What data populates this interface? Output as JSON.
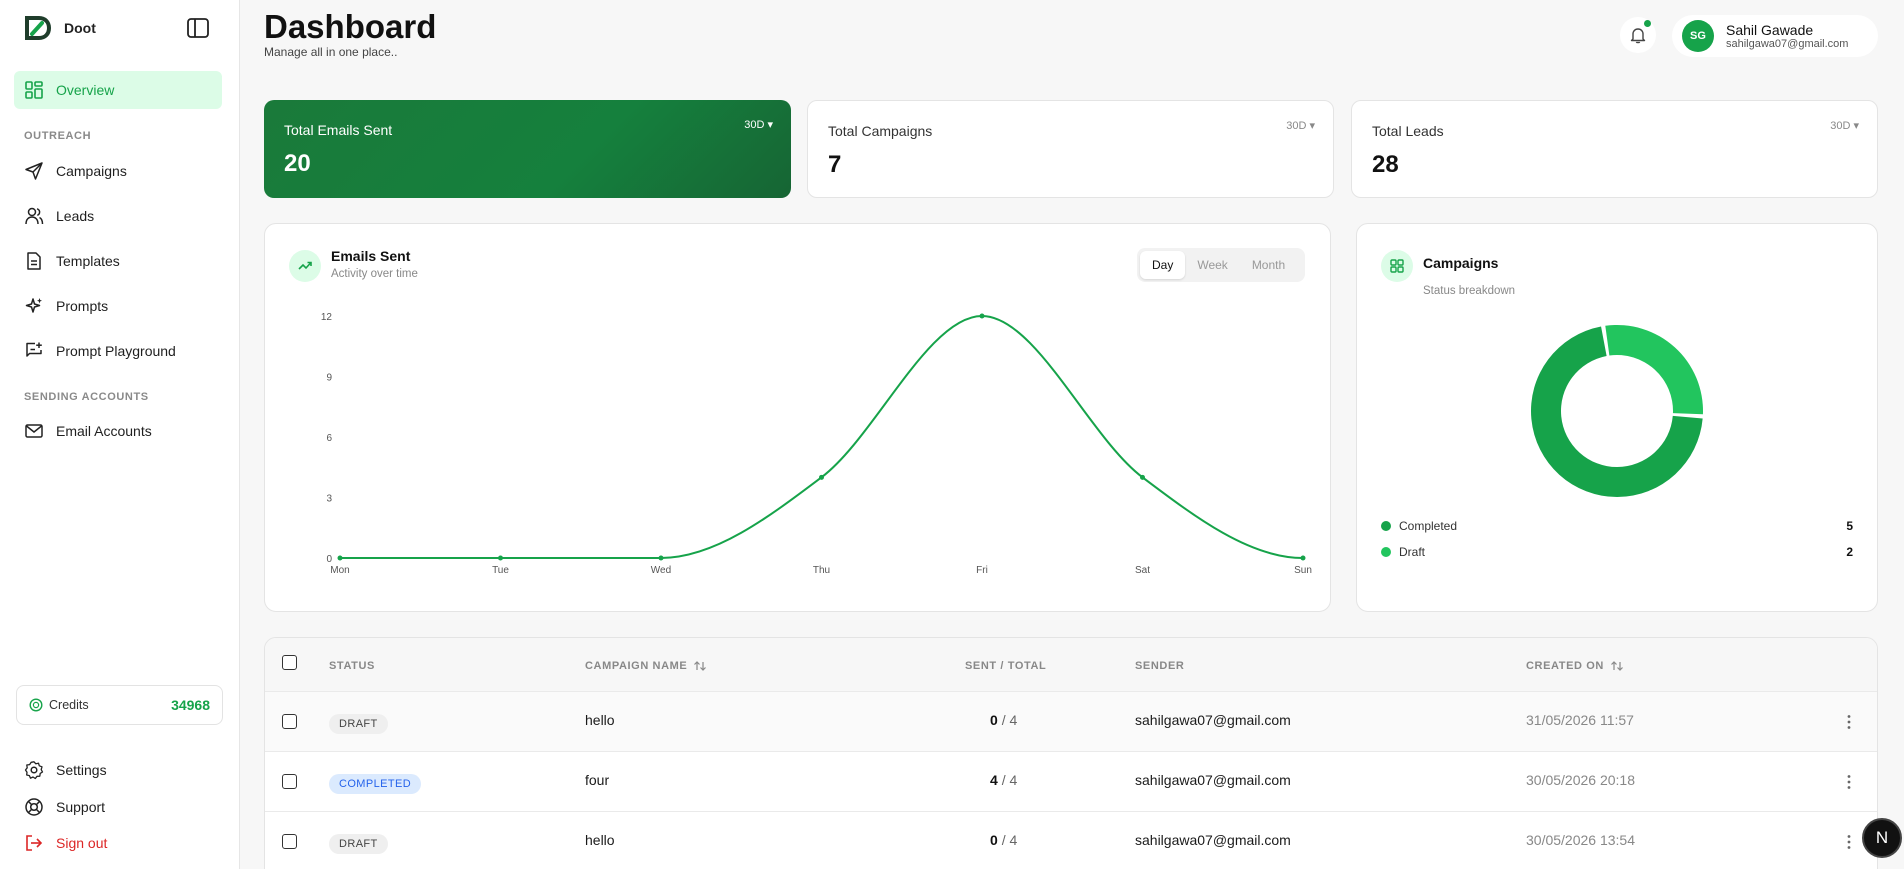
{
  "app": {
    "name": "Doot"
  },
  "sidebar": {
    "overview_label": "Overview",
    "outreach_heading": "OUTREACH",
    "outreach_items": [
      {
        "label": "Campaigns",
        "icon": "send-icon"
      },
      {
        "label": "Leads",
        "icon": "users-icon"
      },
      {
        "label": "Templates",
        "icon": "file-text-icon"
      },
      {
        "label": "Prompts",
        "icon": "sparkles-icon"
      },
      {
        "label": "Prompt Playground",
        "icon": "message-plus-icon"
      }
    ],
    "sending_heading": "SENDING ACCOUNTS",
    "email_accounts_label": "Email Accounts",
    "credits_label": "Credits",
    "credits_value": "34968",
    "settings_label": "Settings",
    "support_label": "Support",
    "signout_label": "Sign out"
  },
  "header": {
    "title": "Dashboard",
    "subtitle": "Manage all in one place..",
    "user_initials": "SG",
    "user_name": "Sahil Gawade",
    "user_email": "sahilgawa07@gmail.com"
  },
  "stats": [
    {
      "label": "Total Emails Sent",
      "value": "20",
      "range": "30D"
    },
    {
      "label": "Total Campaigns",
      "value": "7",
      "range": "30D"
    },
    {
      "label": "Total Leads",
      "value": "28",
      "range": "30D"
    }
  ],
  "emails_panel": {
    "title": "Emails Sent",
    "subtitle": "Activity over time",
    "tabs": [
      "Day",
      "Week",
      "Month"
    ],
    "active_tab": "Day"
  },
  "campaigns_panel": {
    "title": "Campaigns",
    "subtitle": "Status breakdown",
    "legend": [
      {
        "label": "Completed",
        "count": "5",
        "color": "#16a34a"
      },
      {
        "label": "Draft",
        "count": "2",
        "color": "#22c55e"
      }
    ]
  },
  "chart_data": [
    {
      "type": "line",
      "title": "Emails Sent",
      "categories": [
        "Mon",
        "Tue",
        "Wed",
        "Thu",
        "Fri",
        "Sat",
        "Sun"
      ],
      "values": [
        0,
        0,
        0,
        4,
        12,
        4,
        0
      ],
      "y_ticks": [
        0,
        3,
        6,
        9,
        12
      ],
      "ylim": [
        0,
        12
      ],
      "color": "#16a34a"
    },
    {
      "type": "pie",
      "title": "Campaigns",
      "labels": [
        "Completed",
        "Draft"
      ],
      "values": [
        5,
        2
      ],
      "colors": [
        "#16a34a",
        "#22c55e"
      ]
    }
  ],
  "table": {
    "columns": {
      "status": "STATUS",
      "name": "CAMPAIGN NAME",
      "sent": "SENT / TOTAL",
      "sender": "SENDER",
      "created": "CREATED ON"
    },
    "rows": [
      {
        "status": "DRAFT",
        "name": "hello",
        "sent": "0",
        "total": "/ 4",
        "sender": "sahilgawa07@gmail.com",
        "created": "31/05/2026 11:57"
      },
      {
        "status": "COMPLETED",
        "name": "four",
        "sent": "4",
        "total": "/ 4",
        "sender": "sahilgawa07@gmail.com",
        "created": "30/05/2026 20:18"
      },
      {
        "status": "DRAFT",
        "name": "hello",
        "sent": "0",
        "total": "/ 4",
        "sender": "sahilgawa07@gmail.com",
        "created": "30/05/2026 13:54"
      }
    ]
  },
  "corner_badge": "N"
}
